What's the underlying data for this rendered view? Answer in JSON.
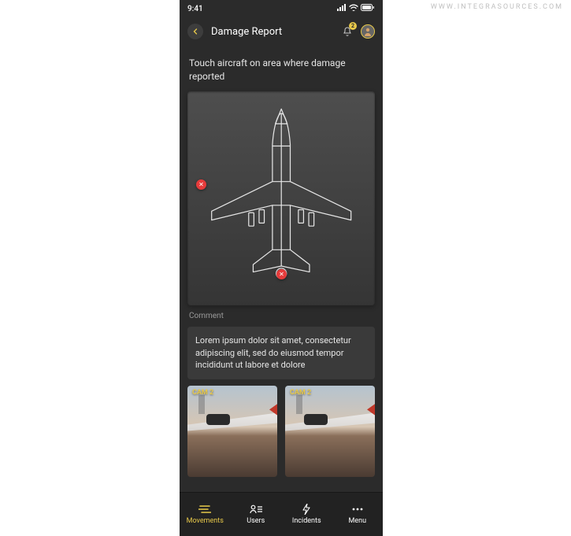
{
  "watermark": "WWW.INTEGRASOURCES.COM",
  "status": {
    "time": "9:41"
  },
  "header": {
    "title": "Damage Report",
    "notification_count": "2"
  },
  "instruction": "Touch aircraft on area where damage reported",
  "comment": {
    "label": "Comment",
    "text": "Lorem ipsum dolor sit amet, consectetur adipiscing elit, sed do eiusmod tempor incididunt ut labore et dolore"
  },
  "thumbnails": [
    {
      "label": "CAM 2"
    },
    {
      "label": "CAM 2"
    }
  ],
  "nav": {
    "items": [
      {
        "label": "Movements"
      },
      {
        "label": "Users"
      },
      {
        "label": "Incidents"
      },
      {
        "label": "Menu"
      }
    ]
  }
}
